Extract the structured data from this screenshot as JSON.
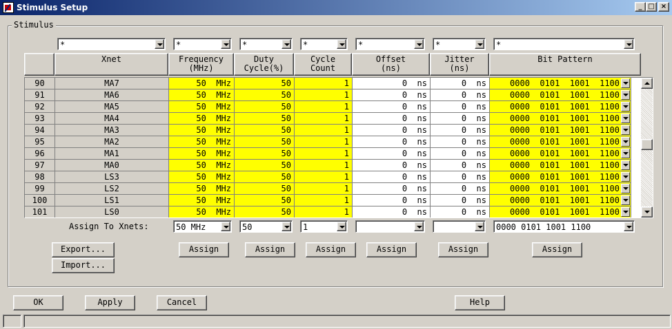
{
  "window": {
    "title": "Stimulus Setup",
    "controls": [
      "_",
      "□",
      "×"
    ]
  },
  "group": {
    "label": "Stimulus"
  },
  "filters": {
    "xnet": "*",
    "frequency": "*",
    "duty": "*",
    "cycle": "*",
    "offset": "*",
    "jitter": "*",
    "bit_pattern": "*"
  },
  "headers": {
    "xnet": "Xnet",
    "frequency": "Frequency\n(MHz)",
    "duty": "Duty\nCycle(%)",
    "cycle": "Cycle\nCount",
    "offset": "Offset\n(ns)",
    "jitter": "Jitter\n(ns)",
    "bit_pattern": "Bit Pattern"
  },
  "rows": [
    {
      "idx": "90",
      "xnet": "MA7",
      "freq": "50  MHz",
      "duty": "50",
      "cycle": "1",
      "offset": "0  ns",
      "jitter": "0  ns",
      "bits": "0000  0101  1001  1100"
    },
    {
      "idx": "91",
      "xnet": "MA6",
      "freq": "50  MHz",
      "duty": "50",
      "cycle": "1",
      "offset": "0  ns",
      "jitter": "0  ns",
      "bits": "0000  0101  1001  1100"
    },
    {
      "idx": "92",
      "xnet": "MA5",
      "freq": "50  MHz",
      "duty": "50",
      "cycle": "1",
      "offset": "0  ns",
      "jitter": "0  ns",
      "bits": "0000  0101  1001  1100"
    },
    {
      "idx": "93",
      "xnet": "MA4",
      "freq": "50  MHz",
      "duty": "50",
      "cycle": "1",
      "offset": "0  ns",
      "jitter": "0  ns",
      "bits": "0000  0101  1001  1100"
    },
    {
      "idx": "94",
      "xnet": "MA3",
      "freq": "50  MHz",
      "duty": "50",
      "cycle": "1",
      "offset": "0  ns",
      "jitter": "0  ns",
      "bits": "0000  0101  1001  1100"
    },
    {
      "idx": "95",
      "xnet": "MA2",
      "freq": "50  MHz",
      "duty": "50",
      "cycle": "1",
      "offset": "0  ns",
      "jitter": "0  ns",
      "bits": "0000  0101  1001  1100"
    },
    {
      "idx": "96",
      "xnet": "MA1",
      "freq": "50  MHz",
      "duty": "50",
      "cycle": "1",
      "offset": "0  ns",
      "jitter": "0  ns",
      "bits": "0000  0101  1001  1100"
    },
    {
      "idx": "97",
      "xnet": "MA0",
      "freq": "50  MHz",
      "duty": "50",
      "cycle": "1",
      "offset": "0  ns",
      "jitter": "0  ns",
      "bits": "0000  0101  1001  1100"
    },
    {
      "idx": "98",
      "xnet": "LS3",
      "freq": "50  MHz",
      "duty": "50",
      "cycle": "1",
      "offset": "0  ns",
      "jitter": "0  ns",
      "bits": "0000  0101  1001  1100"
    },
    {
      "idx": "99",
      "xnet": "LS2",
      "freq": "50  MHz",
      "duty": "50",
      "cycle": "1",
      "offset": "0  ns",
      "jitter": "0  ns",
      "bits": "0000  0101  1001  1100"
    },
    {
      "idx": "100",
      "xnet": "LS1",
      "freq": "50  MHz",
      "duty": "50",
      "cycle": "1",
      "offset": "0  ns",
      "jitter": "0  ns",
      "bits": "0000  0101  1001  1100"
    },
    {
      "idx": "101",
      "xnet": "LS0",
      "freq": "50  MHz",
      "duty": "50",
      "cycle": "1",
      "offset": "0  ns",
      "jitter": "0  ns",
      "bits": "0000  0101  1001  1100"
    }
  ],
  "assign": {
    "label": "Assign To Xnets:",
    "frequency": "50 MHz",
    "duty": "50",
    "cycle": "1",
    "offset": "",
    "jitter": "",
    "bit_pattern": "0000 0101 1001 1100",
    "button_label": "Assign"
  },
  "buttons": {
    "export": "Export...",
    "import": "Import...",
    "ok": "OK",
    "apply": "Apply",
    "cancel": "Cancel",
    "help": "Help"
  },
  "colors": {
    "highlight": "#ffff00",
    "face": "#d4d0c8",
    "title_start": "#0a246a",
    "title_end": "#a6caf0"
  }
}
